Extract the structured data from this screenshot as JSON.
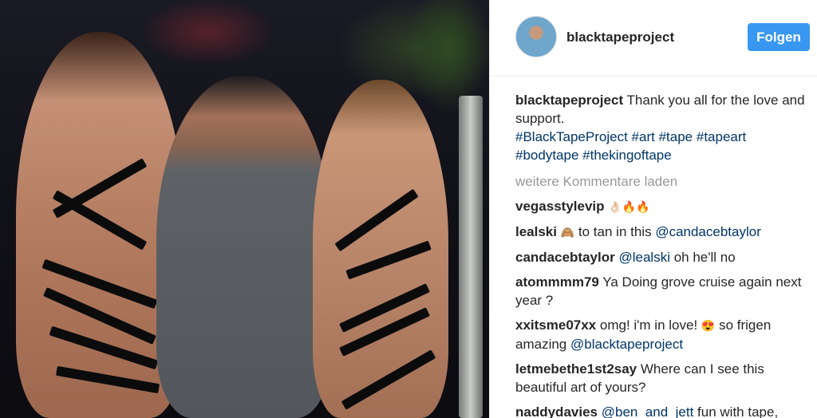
{
  "header": {
    "username": "blacktapeproject",
    "follow_label": "Folgen"
  },
  "caption": {
    "username": "blacktapeproject",
    "text": "Thank you all for the love and support.",
    "hashtags": [
      "#BlackTapeProject",
      "#art",
      "#tape",
      "#tapeart",
      "#bodytape",
      "#thekingoftape"
    ]
  },
  "load_more_label": "weitere Kommentare laden",
  "comments": [
    {
      "username": "vegasstylevip",
      "text": "👌🏻🔥🔥"
    },
    {
      "username": "lealski",
      "emoji": "🙈",
      "text": "to tan in this",
      "mention": "@candacebtaylor"
    },
    {
      "username": "candacebtaylor",
      "mention": "@lealski",
      "text": "oh he'll no"
    },
    {
      "username": "atommmm79",
      "text": "Ya Doing grove cruise again next year ?"
    },
    {
      "username": "xxitsme07xx",
      "text": "omg! i'm in love!",
      "emoji": "😍",
      "text2": "so frigen amazing",
      "mention": "@blacktapeproject"
    },
    {
      "username": "letmebethe1st2say",
      "text": "Where can I see this beautiful art of yours?"
    },
    {
      "username": "naddydavies",
      "mention": "@ben_and_jett",
      "text": "fun with tape,"
    }
  ],
  "colors": {
    "follow_button": "#3897f0",
    "link": "#003569",
    "muted": "#999999",
    "text": "#262626"
  }
}
